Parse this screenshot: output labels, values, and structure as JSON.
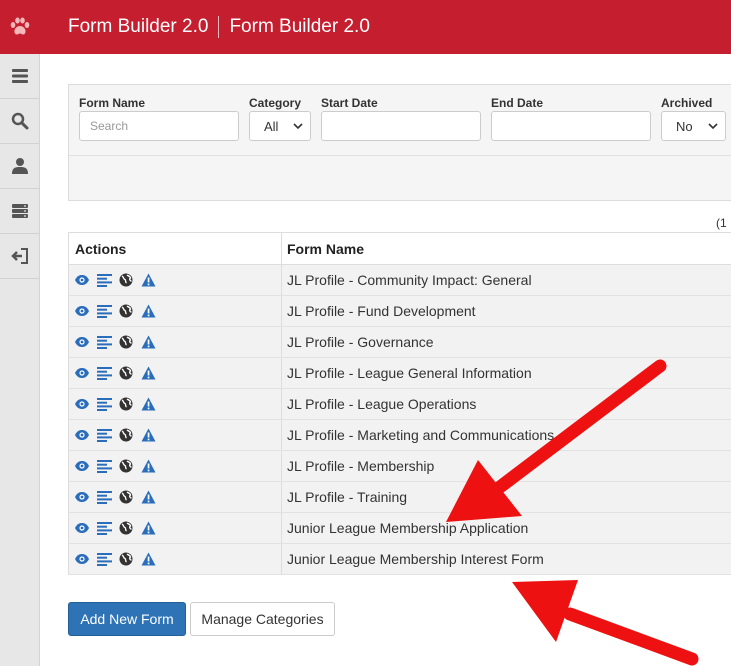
{
  "header": {
    "app_name": "Form Builder 2.0",
    "page_name": "Form Builder 2.0",
    "logo_icon": "paw-icon",
    "brand_color": "#c41e2f"
  },
  "sidebar": {
    "items": [
      {
        "icon": "menu-icon"
      },
      {
        "icon": "search-icon"
      },
      {
        "icon": "user-icon"
      },
      {
        "icon": "server-icon"
      },
      {
        "icon": "sign-out-icon"
      }
    ]
  },
  "filters": {
    "form_name": {
      "label": "Form Name",
      "placeholder": "Search"
    },
    "category": {
      "label": "Category",
      "value": "All"
    },
    "start_date": {
      "label": "Start Date",
      "value": ""
    },
    "end_date": {
      "label": "End Date",
      "value": ""
    },
    "archived": {
      "label": "Archived",
      "value": "No"
    }
  },
  "pager_text": "(1",
  "table": {
    "columns": [
      "Actions",
      "Form Name"
    ],
    "action_icons": [
      "eye-icon",
      "list-icon",
      "globe-icon",
      "warning-icon"
    ],
    "rows": [
      "JL Profile - Community Impact: General",
      "JL Profile - Fund Development",
      "JL Profile - Governance",
      "JL Profile - League General Information",
      "JL Profile - League Operations",
      "JL Profile - Marketing and Communications",
      "JL Profile - Membership",
      "JL Profile - Training",
      "Junior League Membership Application",
      "Junior League Membership Interest Form"
    ]
  },
  "buttons": {
    "add_new_form": "Add New Form",
    "manage_categories": "Manage Categories"
  },
  "colors": {
    "primary": "#2e73b6",
    "icon_blue": "#2a6ebb",
    "annotation_arrow": "#ee1111"
  }
}
